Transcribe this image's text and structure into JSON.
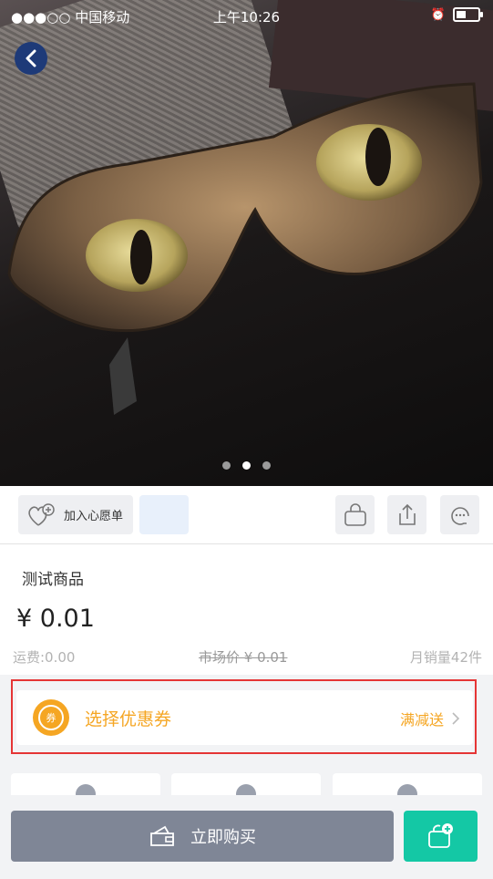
{
  "status_bar": {
    "carrier": "●●●○○ 中国移动",
    "time": "上午10:26"
  },
  "carousel": {
    "image_description_icon": "cat-eye-glasses-photo",
    "pages": 3,
    "active_index": 1
  },
  "actions": {
    "wishlist_label": "加入心愿单",
    "icons": [
      "bag-icon",
      "share-icon",
      "customer-service-icon"
    ]
  },
  "product": {
    "title": "测试商品",
    "price": "¥ 0.01",
    "shipping": "运费:0.00",
    "market_price": "市场价 ¥ 0.01",
    "monthly_sales": "月销量42件"
  },
  "coupon": {
    "badge": "券",
    "label": "选择优惠券",
    "promo": "满减送"
  },
  "bottom": {
    "buy_label": "立即购买"
  },
  "colors": {
    "accent": "#f5a623",
    "highlight": "#e53535",
    "buy_button": "#7f8696",
    "cart_button": "#14c8a5",
    "back_button": "#1e3a78"
  }
}
